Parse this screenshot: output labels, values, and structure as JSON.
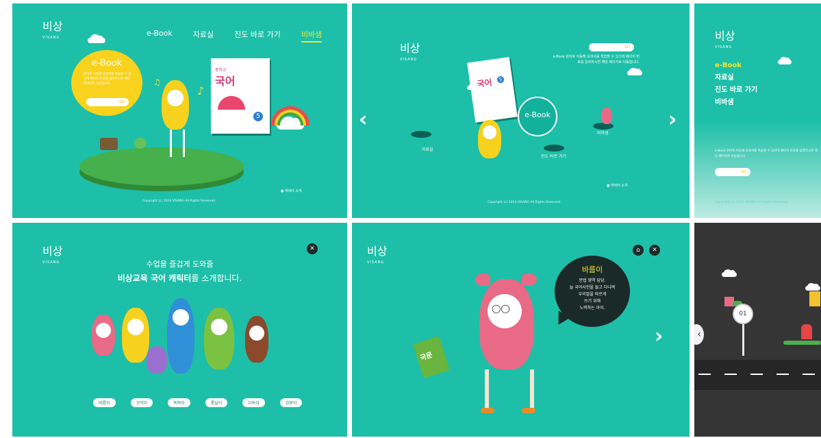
{
  "colors": {
    "teal": "#1dbfa8",
    "yellow": "#f8e42c",
    "dark": "#353535",
    "pink": "#e86a86",
    "green": "#3aa84a"
  },
  "logo": {
    "mark": "비상",
    "sub": "VISANG"
  },
  "panel1": {
    "nav": [
      "e-Book",
      "자료실",
      "진도 바로 가기",
      "비바샘"
    ],
    "nav_active": "비바샘",
    "bubble_title": "e-Book",
    "bubble_text": "원어로 이동해 교과서를 학습할 수 있으며 페이지 번호를 입력하시면 해당 페이지로 이동합니다.",
    "go": "GO",
    "book_title": "국어",
    "book_top": "중학교",
    "book_num": "5",
    "char_intro": "캐릭터 소개",
    "copyright": "Copyright (c) 2014 VISANG All Rights Reserved."
  },
  "panel2": {
    "go": "GO",
    "desc": "e-Book 원어로 이동해 교과서를 학습할 수 있으며 페이지 번호를 입력하시면 해당 페이지로 이동합니다.",
    "ebook": "e-Book",
    "labels": [
      "자료실",
      "진도 바로 가기",
      "비바샘"
    ],
    "book_title": "국어",
    "book_num": "5",
    "char_intro": "캐릭터 소개",
    "copyright": "Copyright (c) 2014 VISANG All Rights Reserved."
  },
  "panel3": {
    "menu": [
      "e-Book",
      "자료실",
      "진도 바로 가기",
      "비바샘"
    ],
    "desc": "e-Book 원어로 이동해 교과서를 학습할 수 있으며 페이지 번호를 입력하시면 해당 페이지로 이동합니다.",
    "go": "GO",
    "copyright": "Copyright (c) 2014 VISANG All Rights Reserved."
  },
  "panel4": {
    "line1": "수업을 즐겁게 도와줄",
    "line2_bold": "비상교육 국어 캐릭터",
    "line2_rest": "를 소개합니다.",
    "names": [
      "바름이",
      "꼬막이",
      "쏙쏙이",
      "통달이",
      "다독이",
      "감동이"
    ]
  },
  "panel5": {
    "name": "바름이",
    "desc": [
      "문법 영역 담당.",
      "늘 국어사전을 들고 다니며",
      "우리말을 바르게",
      "쓰기 위해",
      "노력하는 아이."
    ],
    "book_text": "국문"
  },
  "panel6": {
    "stop": "01"
  }
}
